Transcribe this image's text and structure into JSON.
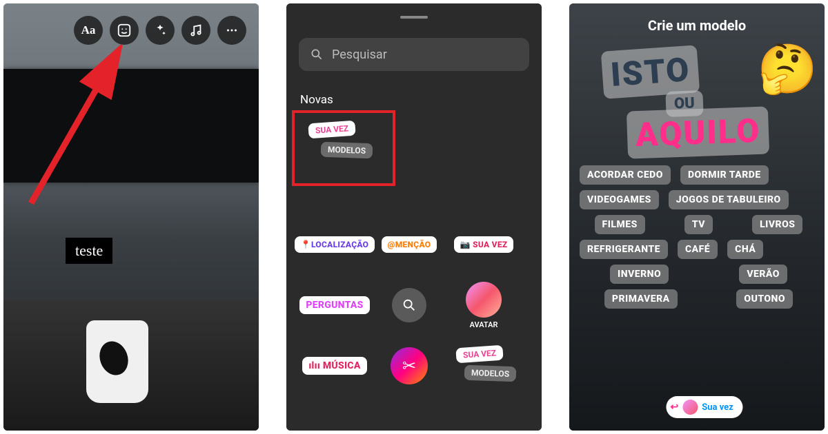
{
  "panel1": {
    "teste": "teste",
    "toolbar_names": [
      "text",
      "sticker",
      "effects",
      "music",
      "more"
    ]
  },
  "panel2": {
    "search_placeholder": "Pesquisar",
    "section": "Novas",
    "sua_vez": "SUA VEZ",
    "modelos": "MODELOS",
    "stickers": {
      "localizacao": "LOCALIZAÇÃO",
      "mencao": "@MENÇÃO",
      "sua_vez2": "SUA VEZ",
      "perguntas": "PERGUNTAS",
      "avatar": "AVATAR",
      "musica": "MÚSICA",
      "sua_vez3": "SUA VEZ",
      "modelos2": "MODELOS",
      "loc_icon": "📍",
      "sv_icon": "📷",
      "mus_icon": "ılıı",
      "scissors": "✂"
    }
  },
  "panel3": {
    "title": "Crie um modelo",
    "isto": "ISTO",
    "ou": "OU",
    "aquilo": "AQUILO",
    "emoji": "🤔",
    "chips": [
      [
        "ACORDAR CEDO",
        "DORMIR TARDE"
      ],
      [
        "VIDEOGAMES",
        "JOGOS DE TABULEIRO"
      ],
      [
        "FILMES",
        "TV",
        "LIVROS"
      ],
      [
        "REFRIGERANTE",
        "CAFÉ",
        "CHÁ"
      ],
      [
        "INVERNO",
        "VERÃO"
      ],
      [
        "PRIMAVERA",
        "OUTONO"
      ]
    ],
    "bottom": {
      "reply": "↩",
      "label": "Sua vez"
    }
  }
}
